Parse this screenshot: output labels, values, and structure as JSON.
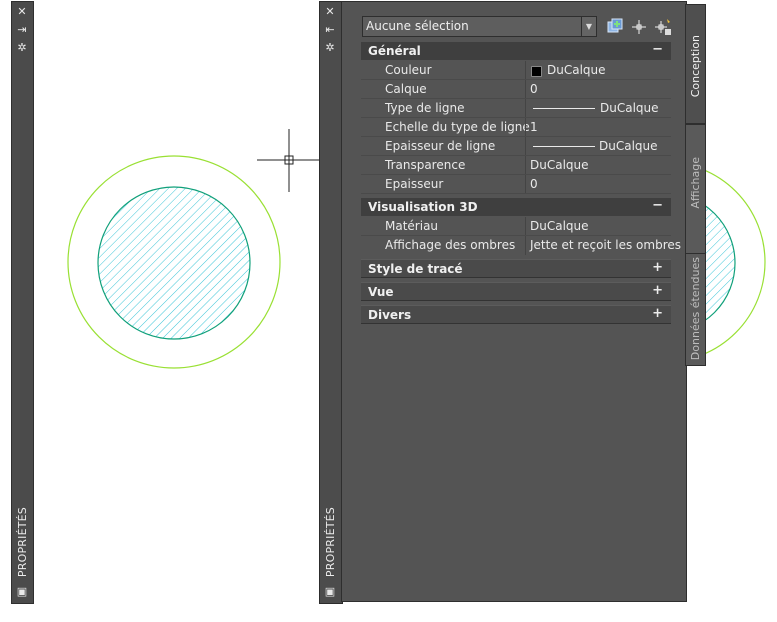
{
  "palette": {
    "title": "PROPRIÉTÉS"
  },
  "selector": {
    "value": "Aucune sélection"
  },
  "sections": {
    "general": {
      "title": "Général",
      "toggle": "−",
      "rows": [
        {
          "label": "Couleur",
          "value": "DuCalque"
        },
        {
          "label": "Calque",
          "value": "0"
        },
        {
          "label": "Type de ligne",
          "value": "DuCalque"
        },
        {
          "label": "Echelle du type de ligne",
          "value": "1"
        },
        {
          "label": "Epaisseur de ligne",
          "value": "DuCalque"
        },
        {
          "label": "Transparence",
          "value": "DuCalque"
        },
        {
          "label": "Epaisseur",
          "value": "0"
        }
      ]
    },
    "vis3d": {
      "title": "Visualisation 3D",
      "toggle": "−",
      "rows": [
        {
          "label": "Matériau",
          "value": "DuCalque"
        },
        {
          "label": "Affichage des ombres",
          "value": "Jette et reçoit les ombres"
        }
      ]
    },
    "style": {
      "title": "Style de tracé",
      "toggle": "+"
    },
    "vue": {
      "title": "Vue",
      "toggle": "+"
    },
    "divers": {
      "title": "Divers",
      "toggle": "+"
    }
  },
  "tabs": {
    "conception": "Conception",
    "affichage": "Affichage",
    "donnees": "Données étendues"
  },
  "colors": {
    "circle_outer": "#99e033",
    "circle_inner": "#10a07a",
    "hatch": "#3ec6d8"
  }
}
